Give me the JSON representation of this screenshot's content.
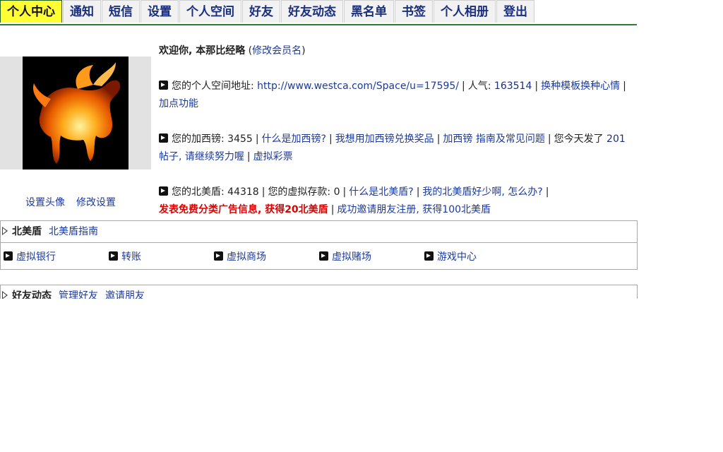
{
  "nav": {
    "tabs": [
      "个人中心",
      "通知",
      "短信",
      "设置",
      "个人空间",
      "好友",
      "好友动态",
      "黑名单",
      "书签",
      "个人相册",
      "登出"
    ],
    "active_index": 0
  },
  "avatar_links": {
    "set_avatar": "设置头像",
    "edit_settings": "修改设置"
  },
  "welcome": {
    "prefix": "欢迎你, ",
    "username": "本那比经略",
    "open_paren": "(",
    "rename_link": "修改会员名",
    "close_paren": ")"
  },
  "space": {
    "label": "您的个人空间地址:",
    "url": "http://www.westca.com/Space/u=17595/",
    "popularity_label": "人气:",
    "popularity_value": "163514",
    "change_template": "换种模板换种心情",
    "add_points": "加点功能"
  },
  "pounds": {
    "label": "您的加西镑:",
    "value": "3455",
    "what_is": "什么是加西镑?",
    "exchange": "我想用加西镑兑换奖品",
    "faq": "加西镑 指南及常见问题",
    "today_prefix": "您今天发了",
    "today_count": "201",
    "today_suffix": "帖子, 请继续努力喔",
    "lottery": "虚拟彩票"
  },
  "shield": {
    "label": "您的北美盾:",
    "value": "44318",
    "deposit_label": "您的虚拟存款:",
    "deposit_value": "0",
    "what_is": "什么是北美盾?",
    "too_few": "我的北美盾好少啊, 怎么办?",
    "free_ad": "发表免费分类广告信息, 获得20北美盾",
    "invite": "成功邀请朋友注册, 获得100北美盾"
  },
  "shield_panel": {
    "title": "北美盾",
    "guide_link": "北美盾指南",
    "items": [
      "虚拟银行",
      "转账",
      "虚拟商场",
      "虚拟赌场",
      "游戏中心"
    ]
  },
  "friends_panel": {
    "title": "好友动态",
    "links": [
      "管理好友",
      "邀请朋友"
    ]
  }
}
